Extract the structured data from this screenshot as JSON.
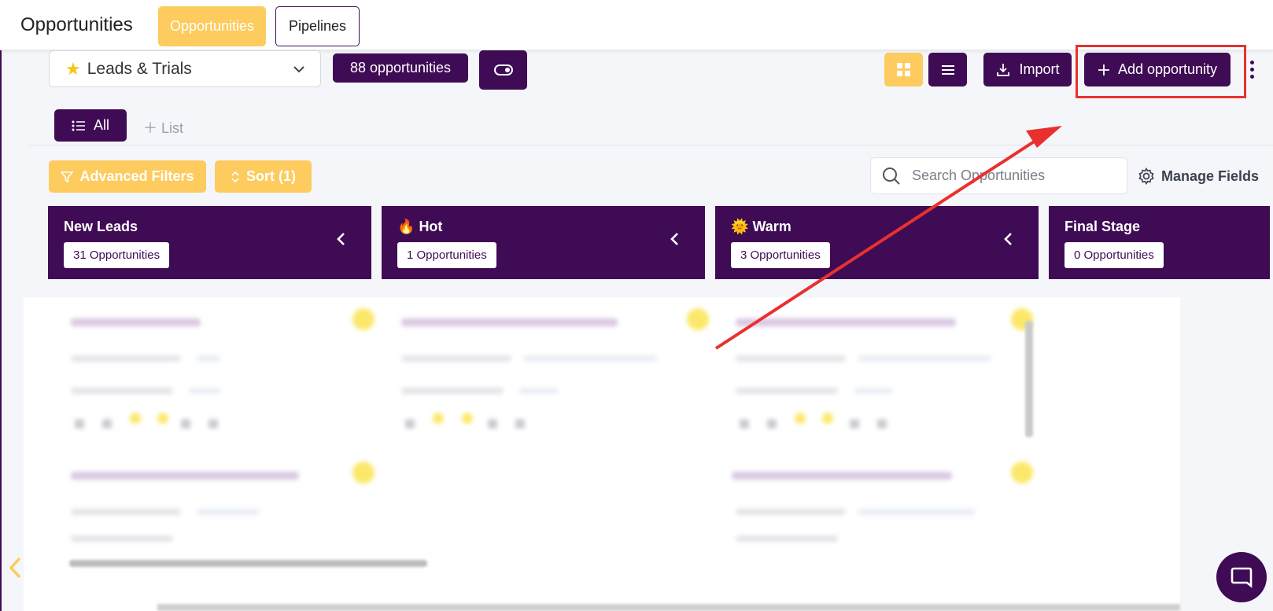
{
  "header": {
    "title": "Opportunities",
    "tabs": [
      {
        "label": "Opportunities",
        "active": true
      },
      {
        "label": "Pipelines",
        "active": false
      }
    ]
  },
  "toolbar": {
    "pipeline_select": {
      "icon": "star-icon",
      "value": "Leads & Trials"
    },
    "count_badge": "88 opportunities",
    "import_label": "Import",
    "add_label": "Add opportunity"
  },
  "views": {
    "all_label": "All",
    "add_list_label": "List"
  },
  "filters": {
    "advanced_label": "Advanced Filters",
    "sort_label": "Sort (1)",
    "search_placeholder": "Search Opportunities",
    "manage_fields_label": "Manage Fields"
  },
  "stages": [
    {
      "name": "New Leads",
      "emoji": "",
      "count": "31 Opportunities"
    },
    {
      "name": "Hot",
      "emoji": "🔥",
      "count": "1 Opportunities"
    },
    {
      "name": "Warm",
      "emoji": "🌞",
      "count": "3 Opportunities"
    },
    {
      "name": "Final Stage",
      "emoji": "",
      "count": "0 Opportunities"
    }
  ],
  "colors": {
    "brand_purple": "#3f0b55",
    "accent_yellow": "#fdcb5e",
    "annotation_red": "#e8312f"
  }
}
